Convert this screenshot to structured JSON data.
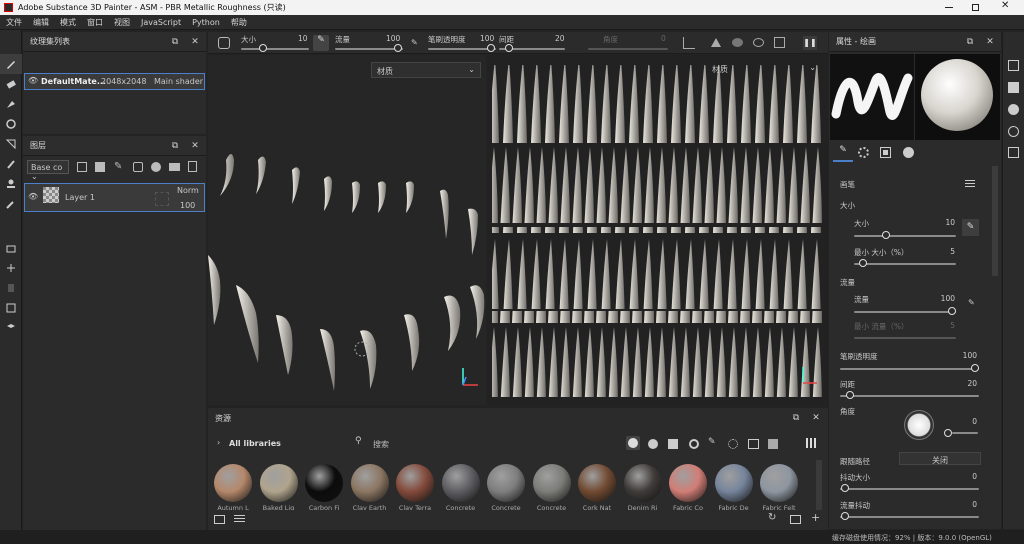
{
  "window": {
    "title": "Adobe Substance 3D Painter - ASM - PBR Metallic Roughness (只读)"
  },
  "menu": [
    "文件",
    "编辑",
    "模式",
    "窗口",
    "视图",
    "JavaScript",
    "Python",
    "帮助"
  ],
  "texture_set": {
    "title": "纹理集列表",
    "material": "DefaultMate...",
    "resolution": "2048x2048",
    "shader": "Main shader"
  },
  "layers": {
    "title": "图层",
    "channel": "Base co",
    "layer_name": "Layer 1",
    "blend": "Norm",
    "opacity": "100"
  },
  "toolbar": {
    "size_label": "大小",
    "size_value": "10",
    "flow_label": "流量",
    "flow_value": "100",
    "opacity_label": "笔刷透明度",
    "opacity_value": "100",
    "spacing_label": "间距",
    "spacing_value": "20",
    "angle_label": "角度",
    "angle_value": "0"
  },
  "viewport": {
    "left_mode": "材质",
    "right_mode": "材质"
  },
  "assets": {
    "title": "资源",
    "library": "All libraries",
    "search_placeholder": "搜索",
    "items": [
      "Autumn L",
      "Baked Lig",
      "Carbon Fi",
      "Clay Earth",
      "Clay Terra",
      "Concrete",
      "Concrete",
      "Concrete",
      "Cork Nat",
      "Denim Ri",
      "Fabric Co",
      "Fabric De",
      "Fabric Felt"
    ]
  },
  "properties": {
    "title": "属性 - 绘画",
    "brush_section": "画笔",
    "size_group": "大小",
    "size_label": "大小",
    "size_value": "10",
    "min_size_label": "最小 大小（%）",
    "min_size_value": "5",
    "flow_group": "流量",
    "flow_label": "流量",
    "flow_value": "100",
    "min_flow_label": "最小 流量（%）",
    "min_flow_value": "5",
    "opacity_label": "笔刷透明度",
    "opacity_value": "100",
    "spacing_label": "间距",
    "spacing_value": "20",
    "angle_label": "角度",
    "angle_value": "0",
    "follow_path_label": "跟随路径",
    "follow_path_value": "关闭",
    "jitter_size_label": "抖动大小",
    "jitter_size_value": "0",
    "jitter_flow_label": "流量抖动",
    "jitter_flow_value": "0"
  },
  "status": {
    "text": "缓存磁盘使用情况：92% | 版本：9.0.0 (OpenGL)"
  },
  "sphere_colors": [
    "#b5886b",
    "#b0a48d",
    "#0c0c0c",
    "#8c7662",
    "#834a3b",
    "#5e5e62",
    "#7e7e7e",
    "#7c7c78",
    "#714a32",
    "#3e3b38",
    "#d17e76",
    "#75849b",
    "#8e96a0"
  ]
}
